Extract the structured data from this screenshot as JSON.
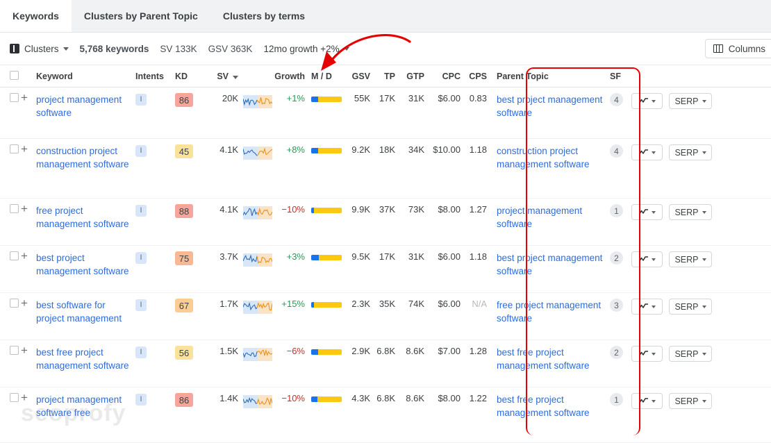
{
  "tabs": [
    {
      "label": "Keywords",
      "active": true
    },
    {
      "label": "Clusters by Parent Topic",
      "active": false
    },
    {
      "label": "Clusters by terms",
      "active": false
    }
  ],
  "toolbar": {
    "clusters_label": "Clusters",
    "keywords_count": "5,768 keywords",
    "sv_total": "SV 133K",
    "gsv_total": "GSV 363K",
    "growth_filter": "12mo growth +2%",
    "columns_label": "Columns"
  },
  "columns": [
    "Keyword",
    "Intents",
    "KD",
    "SV",
    "Growth",
    "M / D",
    "GSV",
    "TP",
    "GTP",
    "CPC",
    "CPS",
    "Parent Topic",
    "SF"
  ],
  "sort_column": "SV",
  "row_controls": {
    "chart_button_label": "",
    "serp_button_label": "SERP"
  },
  "rows": [
    {
      "keyword": "project management software",
      "intent": "I",
      "kd": "86",
      "kd_color": "#f7a49b",
      "sv": "20K",
      "growth": "+1%",
      "growth_dir": "pos",
      "md_blue_pct": 22,
      "gsv": "55K",
      "tp": "17K",
      "gtp": "31K",
      "cpc": "$6.00",
      "cps": "0.83",
      "parent_topic": "best project management software",
      "sf": "4",
      "serp": "SERP"
    },
    {
      "keyword": "construction project management software",
      "intent": "I",
      "kd": "45",
      "kd_color": "#fae29a",
      "sv": "4.1K",
      "growth": "+8%",
      "growth_dir": "pos",
      "md_blue_pct": 22,
      "gsv": "9.2K",
      "tp": "18K",
      "gtp": "34K",
      "cpc": "$10.00",
      "cps": "1.18",
      "parent_topic": "construction project management software",
      "sf": "4",
      "serp": "SERP"
    },
    {
      "keyword": "free project management software",
      "intent": "I",
      "kd": "88",
      "kd_color": "#f7a49b",
      "sv": "4.1K",
      "growth": "−10%",
      "growth_dir": "neg",
      "md_blue_pct": 10,
      "gsv": "9.9K",
      "tp": "37K",
      "gtp": "73K",
      "cpc": "$8.00",
      "cps": "1.27",
      "parent_topic": "project management software",
      "sf": "1",
      "serp": "SERP"
    },
    {
      "keyword": "best project management software",
      "intent": "I",
      "kd": "75",
      "kd_color": "#f9b894",
      "sv": "3.7K",
      "growth": "+3%",
      "growth_dir": "pos",
      "md_blue_pct": 24,
      "gsv": "9.5K",
      "tp": "17K",
      "gtp": "31K",
      "cpc": "$6.00",
      "cps": "1.18",
      "parent_topic": "best project management software",
      "sf": "2",
      "serp": "SERP"
    },
    {
      "keyword": "best software for project management",
      "intent": "I",
      "kd": "67",
      "kd_color": "#fbcd93",
      "sv": "1.7K",
      "growth": "+15%",
      "growth_dir": "pos",
      "md_blue_pct": 8,
      "gsv": "2.3K",
      "tp": "35K",
      "gtp": "74K",
      "cpc": "$6.00",
      "cps": "N/A",
      "parent_topic": "free project management software",
      "sf": "3",
      "serp": "SERP"
    },
    {
      "keyword": "best free project management software",
      "intent": "I",
      "kd": "56",
      "kd_color": "#fae29a",
      "sv": "1.5K",
      "growth": "−6%",
      "growth_dir": "neg",
      "md_blue_pct": 22,
      "gsv": "2.9K",
      "tp": "6.8K",
      "gtp": "8.6K",
      "cpc": "$7.00",
      "cps": "1.28",
      "parent_topic": "best free project management software",
      "sf": "2",
      "serp": "SERP"
    },
    {
      "keyword": "project management software free",
      "intent": "I",
      "kd": "86",
      "kd_color": "#f7a49b",
      "sv": "1.4K",
      "growth": "−10%",
      "growth_dir": "neg",
      "md_blue_pct": 20,
      "gsv": "4.3K",
      "tp": "6.8K",
      "gtp": "8.6K",
      "cpc": "$8.00",
      "cps": "1.22",
      "parent_topic": "best free project management software",
      "sf": "1",
      "serp": "SERP"
    }
  ],
  "annotations": {
    "highlight_color": "#e60000",
    "arrow_color": "#e60000",
    "highlighted_column": "Parent Topic"
  },
  "watermark": "seoprofy"
}
